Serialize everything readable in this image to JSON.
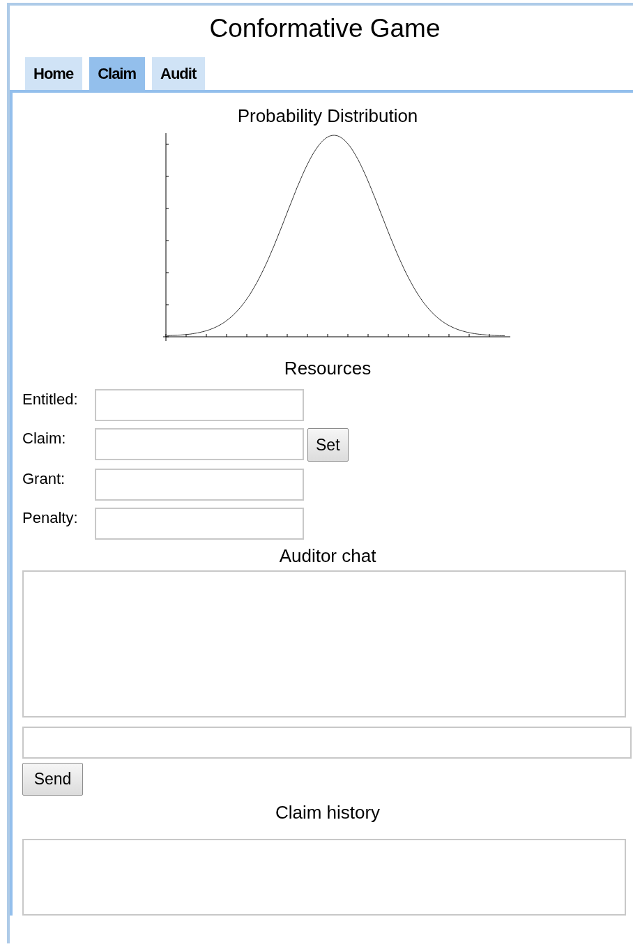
{
  "title": "Conformative Game",
  "tabs": [
    {
      "label": "Home",
      "selected": false
    },
    {
      "label": "Claim",
      "selected": true
    },
    {
      "label": "Audit",
      "selected": false
    }
  ],
  "chart": {
    "title": "Probability Distribution"
  },
  "resources": {
    "title": "Resources",
    "fields": [
      {
        "label": "Entitled:"
      },
      {
        "label": "Claim:",
        "button": "Set"
      },
      {
        "label": "Grant:"
      },
      {
        "label": "Penalty:"
      }
    ]
  },
  "auditor_chat": {
    "title": "Auditor chat",
    "send_button": "Send"
  },
  "claim_history": {
    "title": "Claim history"
  }
}
